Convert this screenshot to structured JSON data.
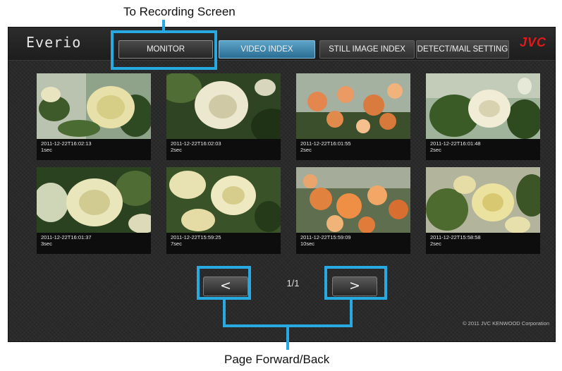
{
  "callouts": {
    "top": "To Recording Screen",
    "bottom": "Page Forward/Back"
  },
  "app": {
    "brand": "Everio",
    "logo": "JVC",
    "tabs": [
      {
        "label": "MONITOR",
        "active": false
      },
      {
        "label": "VIDEO INDEX",
        "active": true
      },
      {
        "label": "STILL IMAGE INDEX",
        "active": false
      },
      {
        "label": "DETECT/MAIL SETTING",
        "active": false
      }
    ],
    "thumbnails": [
      {
        "timestamp": "2011-12-22T16:02:13",
        "duration": "1sec"
      },
      {
        "timestamp": "2011-12-22T16:02:03",
        "duration": "2sec"
      },
      {
        "timestamp": "2011-12-22T16:01:55",
        "duration": "2sec"
      },
      {
        "timestamp": "2011-12-22T16:01:48",
        "duration": "2sec"
      },
      {
        "timestamp": "2011-12-22T16:01:37",
        "duration": "3sec"
      },
      {
        "timestamp": "2011-12-22T15:59:25",
        "duration": "7sec"
      },
      {
        "timestamp": "2011-12-22T15:59:09",
        "duration": "10sec"
      },
      {
        "timestamp": "2011-12-22T15:58:58",
        "duration": "2sec"
      }
    ],
    "pager": {
      "prev_label": "<",
      "next_label": ">",
      "page": "1/1"
    },
    "copyright": "© 2011 JVC KENWOOD Corporation"
  },
  "colors": {
    "highlight": "#28a9e2",
    "active_tab": "#3f87b0",
    "logo_red": "#e01a1a"
  }
}
